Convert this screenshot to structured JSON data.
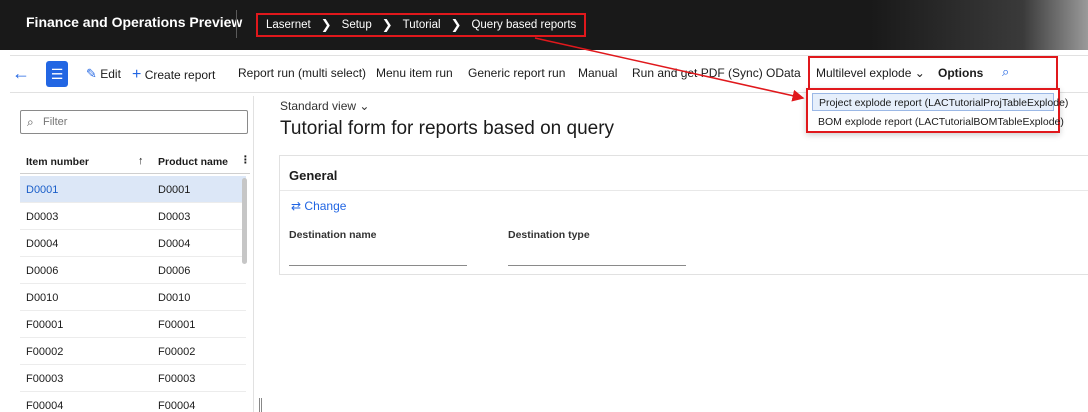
{
  "app": {
    "title": "Finance and Operations Preview"
  },
  "breadcrumb": {
    "items": [
      "Lasernet",
      "Setup",
      "Tutorial",
      "Query based reports"
    ],
    "separator": "❯"
  },
  "toolbar": {
    "back_icon": "back-arrow-icon",
    "menu_icon": "hamburger-icon",
    "edit": "Edit",
    "create_report": "Create report",
    "report_run_multi": "Report run (multi select)",
    "menu_item_run": "Menu item run",
    "generic_report_run": "Generic report run",
    "manual": "Manual",
    "run_get_pdf": "Run and get PDF (Sync)",
    "odata": "OData",
    "multilevel_explode": "Multilevel explode",
    "options": "Options",
    "search_icon": "search-icon"
  },
  "dropdown": {
    "items": [
      "Project explode report (LACTutorialProjTableExplode)",
      "BOM explode report (LACTutorialBOMTableExplode)"
    ]
  },
  "list": {
    "filter_placeholder": "Filter",
    "columns": [
      "Item number",
      "Product name"
    ],
    "sort_indicator": "↑",
    "more_indicator": "⋮",
    "rows": [
      [
        "D0001",
        "D0001"
      ],
      [
        "D0003",
        "D0003"
      ],
      [
        "D0004",
        "D0004"
      ],
      [
        "D0006",
        "D0006"
      ],
      [
        "D0010",
        "D0010"
      ],
      [
        "F00001",
        "F00001"
      ],
      [
        "F00002",
        "F00002"
      ],
      [
        "F00003",
        "F00003"
      ],
      [
        "F00004",
        "F00004"
      ]
    ]
  },
  "form": {
    "view": "Standard view",
    "title": "Tutorial form for reports based on query",
    "section": "General",
    "change": "Change",
    "destination_name_label": "Destination name",
    "destination_type_label": "Destination type"
  },
  "colors": {
    "accent": "#2266e3",
    "annotation": "#e0181c",
    "nav": "#191919"
  }
}
